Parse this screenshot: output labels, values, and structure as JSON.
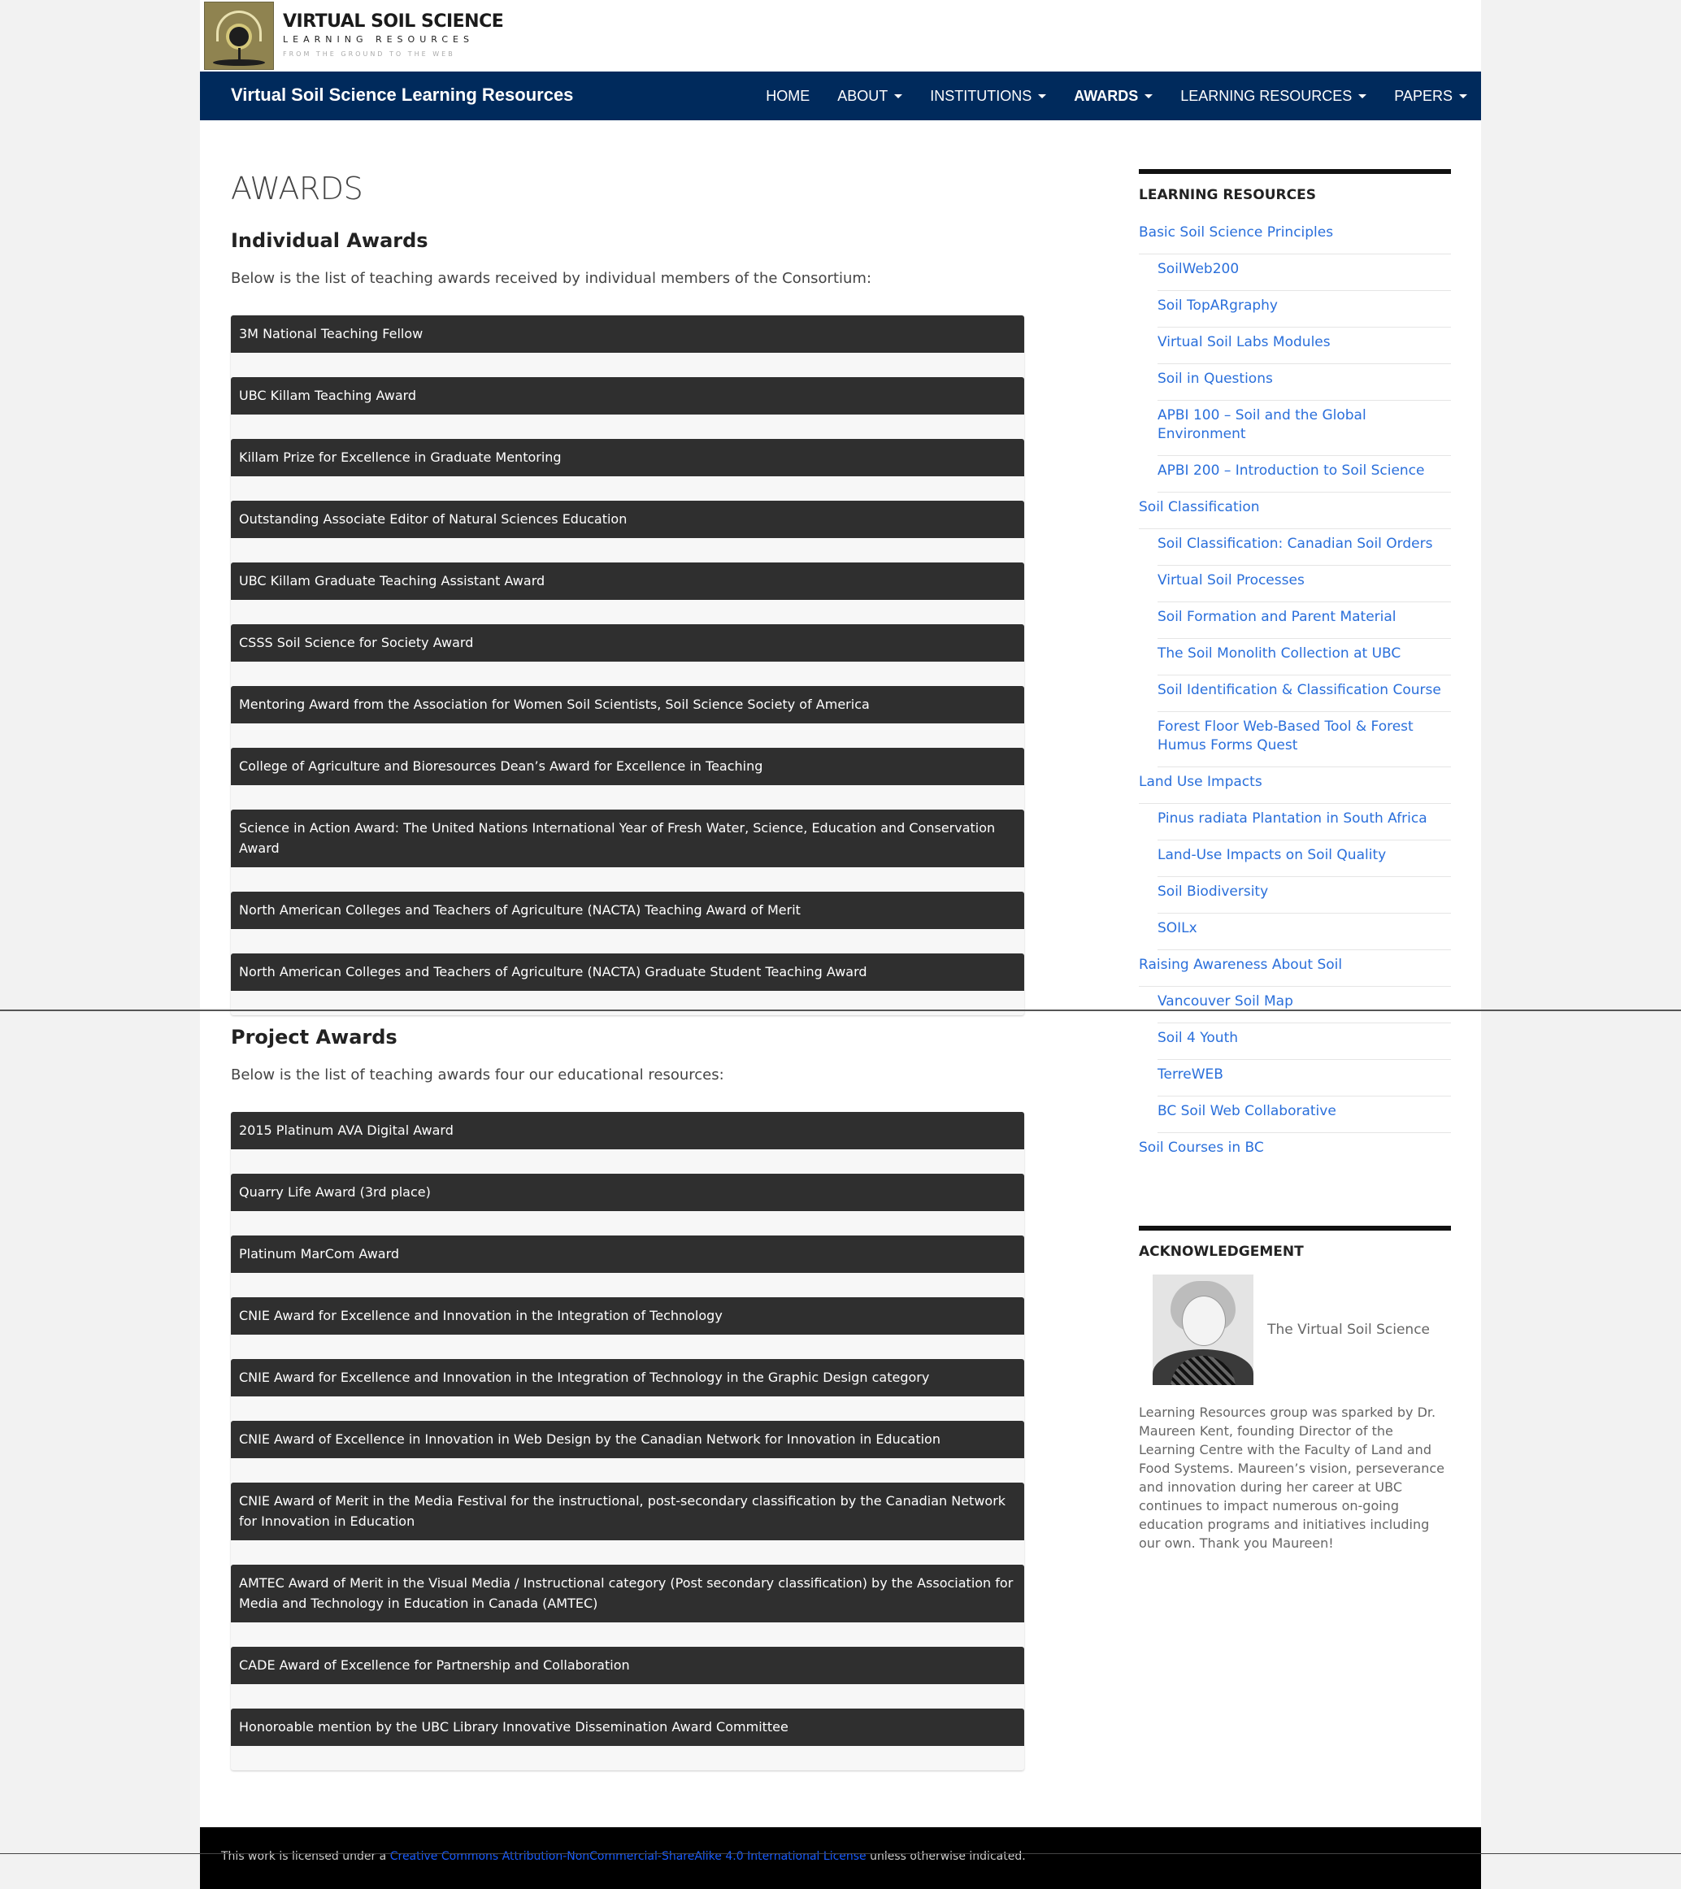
{
  "logo": {
    "title": "VIRTUAL SOIL SCIENCE",
    "subtitle": "LEARNING RESOURCES",
    "tagline": "FROM THE GROUND TO THE WEB"
  },
  "navbar": {
    "brand": "Virtual Soil Science Learning Resources",
    "items": [
      {
        "label": "HOME"
      },
      {
        "label": "ABOUT"
      },
      {
        "label": "INSTITUTIONS"
      },
      {
        "label": "AWARDS"
      },
      {
        "label": "LEARNING RESOURCES"
      },
      {
        "label": "PAPERS"
      }
    ]
  },
  "main": {
    "page_title": "AWARDS",
    "individual": {
      "title": "Individual Awards",
      "intro": "Below is the list of teaching awards received by individual members of the Consortium:",
      "awards": [
        "3M National Teaching Fellow",
        "UBC Killam Teaching Award",
        "Killam Prize for Excellence in Graduate Mentoring",
        "Outstanding Associate Editor of Natural Sciences Education",
        "UBC Killam Graduate Teaching Assistant Award",
        "CSSS Soil Science for Society Award",
        "Mentoring Award from the Association for Women Soil Scientists, Soil Science Society of America",
        "College of Agriculture and Bioresources Dean’s Award for Excellence in Teaching",
        "Science in Action Award: The United Nations International Year of Fresh Water, Science, Education and Conservation Award",
        "North American Colleges and Teachers of Agriculture (NACTA) Teaching Award of Merit",
        "North American Colleges and Teachers of Agriculture (NACTA) Graduate Student Teaching Award"
      ]
    },
    "project": {
      "title": "Project Awards",
      "intro": "Below is the list of teaching awards four our educational resources:",
      "awards": [
        "2015 Platinum AVA Digital Award",
        "Quarry Life Award (3rd place)",
        "Platinum MarCom Award",
        "CNIE Award for Excellence and Innovation in the Integration of Technology",
        "CNIE Award for Excellence and Innovation in the Integration of Technology in the Graphic Design category",
        "CNIE Award of Excellence in Innovation in Web Design by the Canadian Network for Innovation in Education",
        "CNIE Award of Merit in the Media Festival for the instructional, post-secondary classification by the Canadian Network for Innovation in Education",
        "AMTEC Award of Merit in the Visual Media / Instructional category (Post secondary classification) by the Association for Media and Technology in Education in Canada (AMTEC)",
        "CADE Award of Excellence for Partnership and Collaboration",
        "Honoroable mention by the UBC Library Innovative Dissemination Award Committee"
      ]
    }
  },
  "sidebar": {
    "resources_title": "LEARNING RESOURCES",
    "resources": [
      {
        "label": "Basic Soil Science Principles",
        "level": 0
      },
      {
        "label": "SoilWeb200",
        "level": 1
      },
      {
        "label": "Soil TopARgraphy",
        "level": 1
      },
      {
        "label": "Virtual Soil Labs Modules",
        "level": 1
      },
      {
        "label": "Soil in Questions",
        "level": 1
      },
      {
        "label": "APBI 100 – Soil and the Global Environment",
        "level": 1
      },
      {
        "label": "APBI 200 – Introduction to Soil Science",
        "level": 1
      },
      {
        "label": "Soil Classification",
        "level": 0
      },
      {
        "label": "Soil Classification: Canadian Soil Orders",
        "level": 1
      },
      {
        "label": "Virtual Soil Processes",
        "level": 1
      },
      {
        "label": "Soil Formation and Parent Material",
        "level": 1
      },
      {
        "label": "The Soil Monolith Collection at UBC",
        "level": 1
      },
      {
        "label": "Soil Identification & Classification Course",
        "level": 1
      },
      {
        "label": "Forest Floor Web-Based Tool & Forest Humus Forms Quest",
        "level": 1
      },
      {
        "label": "Land Use Impacts",
        "level": 0
      },
      {
        "label": "Pinus radiata Plantation in South Africa",
        "level": 1
      },
      {
        "label": "Land-Use Impacts on Soil Quality",
        "level": 1
      },
      {
        "label": "Soil Biodiversity",
        "level": 1
      },
      {
        "label": "SOILx",
        "level": 1
      },
      {
        "label": "Raising Awareness About Soil",
        "level": 0
      },
      {
        "label": "Vancouver Soil Map",
        "level": 1
      },
      {
        "label": "Soil 4 Youth",
        "level": 1
      },
      {
        "label": "TerreWEB",
        "level": 1
      },
      {
        "label": "BC Soil Web Collaborative",
        "level": 1
      },
      {
        "label": "Soil Courses in BC",
        "level": 0
      }
    ],
    "ack_title": "ACKNOWLEDGEMENT",
    "ack_inline": "The Virtual Soil Science",
    "ack_text": "Learning Resources group was sparked by Dr. Maureen Kent, founding Director of the Learning Centre with the Faculty of Land and Food Systems. Maureen’s vision, perseverance and in­novation during her career at UBC continues to impact numerous on-going education programs and initiatives including our own. Thank you Maureen!"
  },
  "footer": {
    "prefix": "This work is licensed under a ",
    "link": "Creative Commons Attribution-NonCommercial-ShareAlike 4.0 International License",
    "suffix": " unless otherwise indicated."
  },
  "colors": {
    "nav_bg": "#002a5c",
    "award_bg": "#2f2f2f",
    "link": "#2a6fdb"
  }
}
